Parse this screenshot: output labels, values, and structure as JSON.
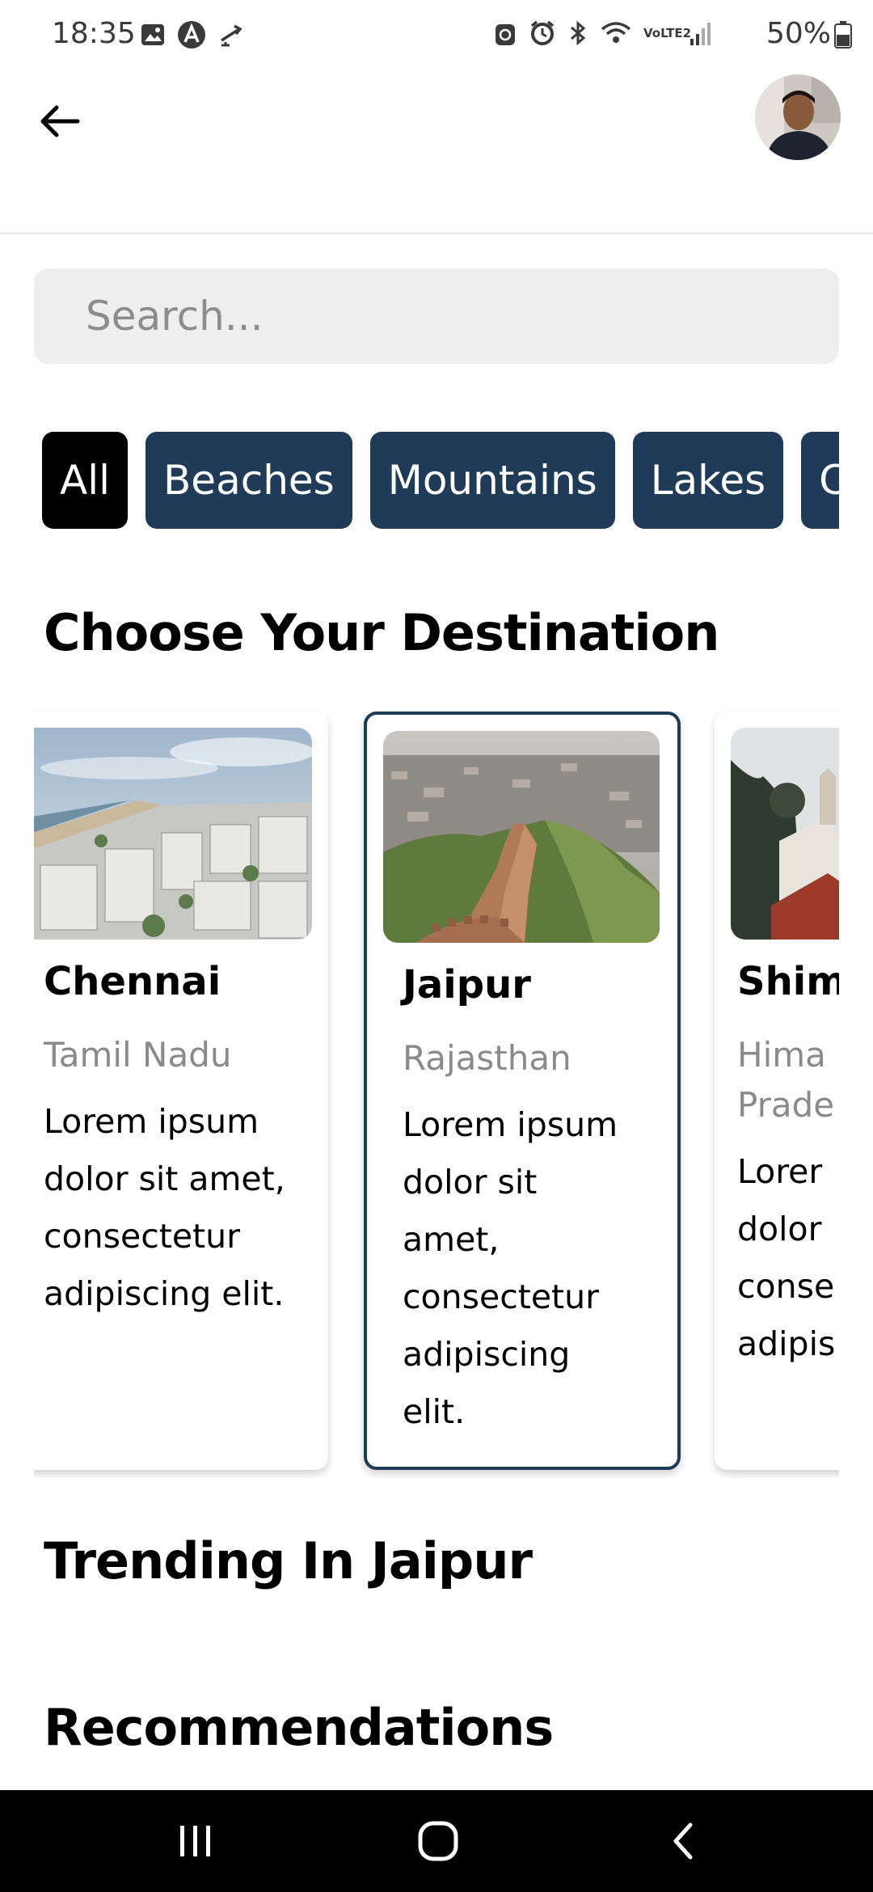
{
  "status_bar": {
    "time": "18:35",
    "battery": "50%",
    "left_icons": [
      "gallery-icon",
      "app-notification-icon",
      "transfer-icon"
    ],
    "right_icons": [
      "lock-sync-icon",
      "alarm-icon",
      "bluetooth-icon",
      "wifi-icon",
      "volte-icon",
      "signal-icon",
      "battery-icon"
    ],
    "network_label": "VoLTE2"
  },
  "header": {
    "back_icon": "arrow-left-icon",
    "avatar_icon": "profile-avatar"
  },
  "search": {
    "placeholder": "Search..."
  },
  "categories": [
    {
      "label": "All",
      "active": true
    },
    {
      "label": "Beaches",
      "active": false
    },
    {
      "label": "Mountains",
      "active": false
    },
    {
      "label": "Lakes",
      "active": false
    },
    {
      "label": "C",
      "active": false
    }
  ],
  "sections": {
    "choose_title": "Choose Your Destination",
    "trending_title": "Trending In Jaipur",
    "recommend_title": "Recommendations"
  },
  "destinations": [
    {
      "name": "Chennai",
      "state": "Tamil Nadu",
      "description": "Lorem ipsum dolor sit amet, consectetur adipiscing elit.",
      "selected": false
    },
    {
      "name": "Jaipur",
      "state": "Rajasthan",
      "description": "Lorem ipsum dolor sit amet, consectetur adipiscing elit.",
      "selected": true
    },
    {
      "name": "Shim",
      "state": "Hima Prade",
      "description": "Lorer dolor conse adipis",
      "selected": false
    }
  ],
  "colors": {
    "chip": "#1f3b57",
    "chip_active": "#000000",
    "card_border_selected": "#1f3b57",
    "search_bg": "#eeeeee"
  },
  "nav_bar": {
    "icons": [
      "recent-apps-icon",
      "home-icon",
      "back-nav-icon"
    ]
  }
}
